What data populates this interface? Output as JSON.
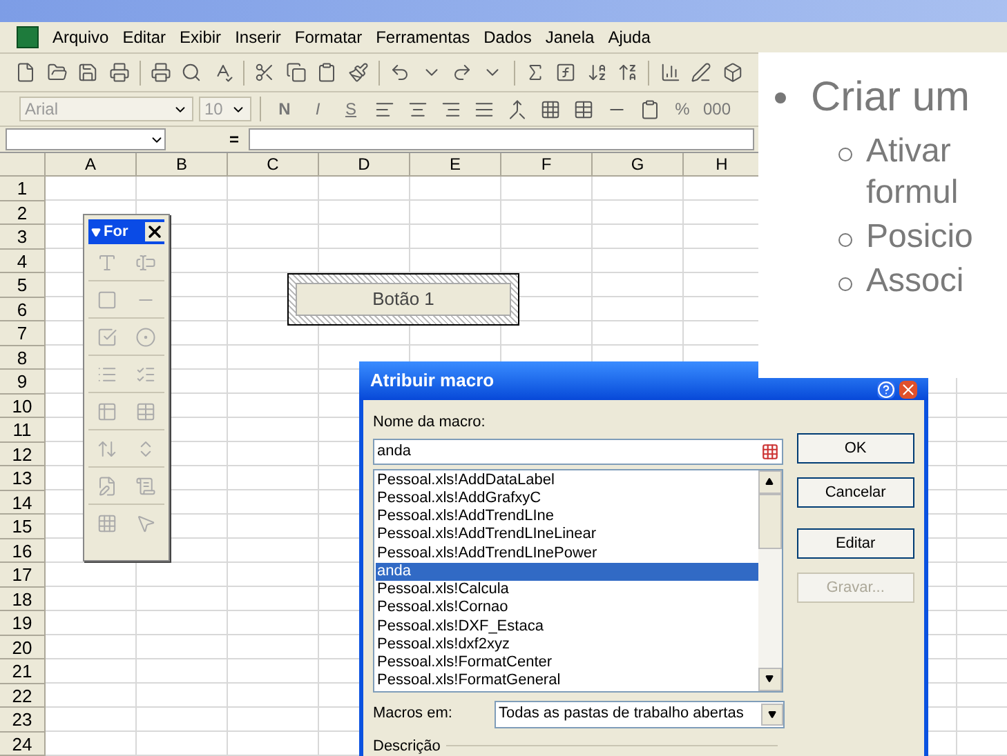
{
  "menu_bar": {
    "items": [
      "Arquivo",
      "Editar",
      "Exibir",
      "Inserir",
      "Formatar",
      "Ferramentas",
      "Dados",
      "Janela",
      "Ajuda"
    ]
  },
  "formatting_toolbar": {
    "font": "Arial",
    "size": "10",
    "buttons": [
      {
        "kind": "text",
        "label": "N"
      },
      {
        "kind": "text",
        "label": "I"
      },
      {
        "kind": "text",
        "label": "S"
      },
      {
        "kind": "icon"
      },
      {
        "kind": "icon"
      },
      {
        "kind": "icon"
      },
      {
        "kind": "icon"
      },
      {
        "kind": "icon"
      },
      {
        "kind": "icon"
      },
      {
        "kind": "icon"
      },
      {
        "kind": "icon"
      },
      {
        "kind": "icon"
      },
      {
        "kind": "text",
        "label": "%"
      },
      {
        "kind": "text",
        "label": "000"
      }
    ]
  },
  "formula_bar": {
    "equals": "="
  },
  "sheet": {
    "columns": [
      "A",
      "B",
      "C",
      "D",
      "E",
      "F",
      "G",
      "H"
    ],
    "rows": [
      "1",
      "2",
      "3",
      "4",
      "5",
      "6",
      "7",
      "8",
      "9",
      "10",
      "11",
      "12",
      "13",
      "14",
      "15",
      "16",
      "17",
      "18",
      "19",
      "20",
      "21",
      "22",
      "23",
      "24"
    ]
  },
  "forms_toolbar": {
    "title": "For"
  },
  "form_button": {
    "label": "Botão 1"
  },
  "dialog": {
    "title": "Atribuir macro",
    "name_label": "Nome da macro:",
    "name_value": "anda",
    "macros": [
      {
        "name": "Pessoal.xls!AddDataLabel",
        "selected": false
      },
      {
        "name": "Pessoal.xls!AddGrafxyC",
        "selected": false
      },
      {
        "name": "Pessoal.xls!AddTrendLIne",
        "selected": false
      },
      {
        "name": "Pessoal.xls!AddTrendLIneLinear",
        "selected": false
      },
      {
        "name": "Pessoal.xls!AddTrendLInePower",
        "selected": false
      },
      {
        "name": "anda",
        "selected": true
      },
      {
        "name": "Pessoal.xls!Calcula",
        "selected": false
      },
      {
        "name": "Pessoal.xls!Cornao",
        "selected": false
      },
      {
        "name": "Pessoal.xls!DXF_Estaca",
        "selected": false
      },
      {
        "name": "Pessoal.xls!dxf2xyz",
        "selected": false
      },
      {
        "name": "Pessoal.xls!FormatCenter",
        "selected": false
      },
      {
        "name": "Pessoal.xls!FormatGeneral",
        "selected": false
      }
    ],
    "buttons": [
      {
        "label": "OK",
        "disabled": false
      },
      {
        "label": "Cancelar",
        "disabled": false
      },
      {
        "label": "Editar",
        "disabled": false
      },
      {
        "label": "Gravar...",
        "disabled": true
      }
    ],
    "macros_in_label": "Macros em:",
    "macros_in_value": "Todas as pastas de trabalho abertas",
    "description_label": "Descrição"
  },
  "slide": {
    "bullets": [
      {
        "text": "Criar um",
        "children": [
          {
            "lines": [
              "Ativar",
              "formul"
            ]
          },
          {
            "lines": [
              "Posicio"
            ]
          },
          {
            "lines": [
              "Associ"
            ]
          }
        ]
      }
    ]
  }
}
